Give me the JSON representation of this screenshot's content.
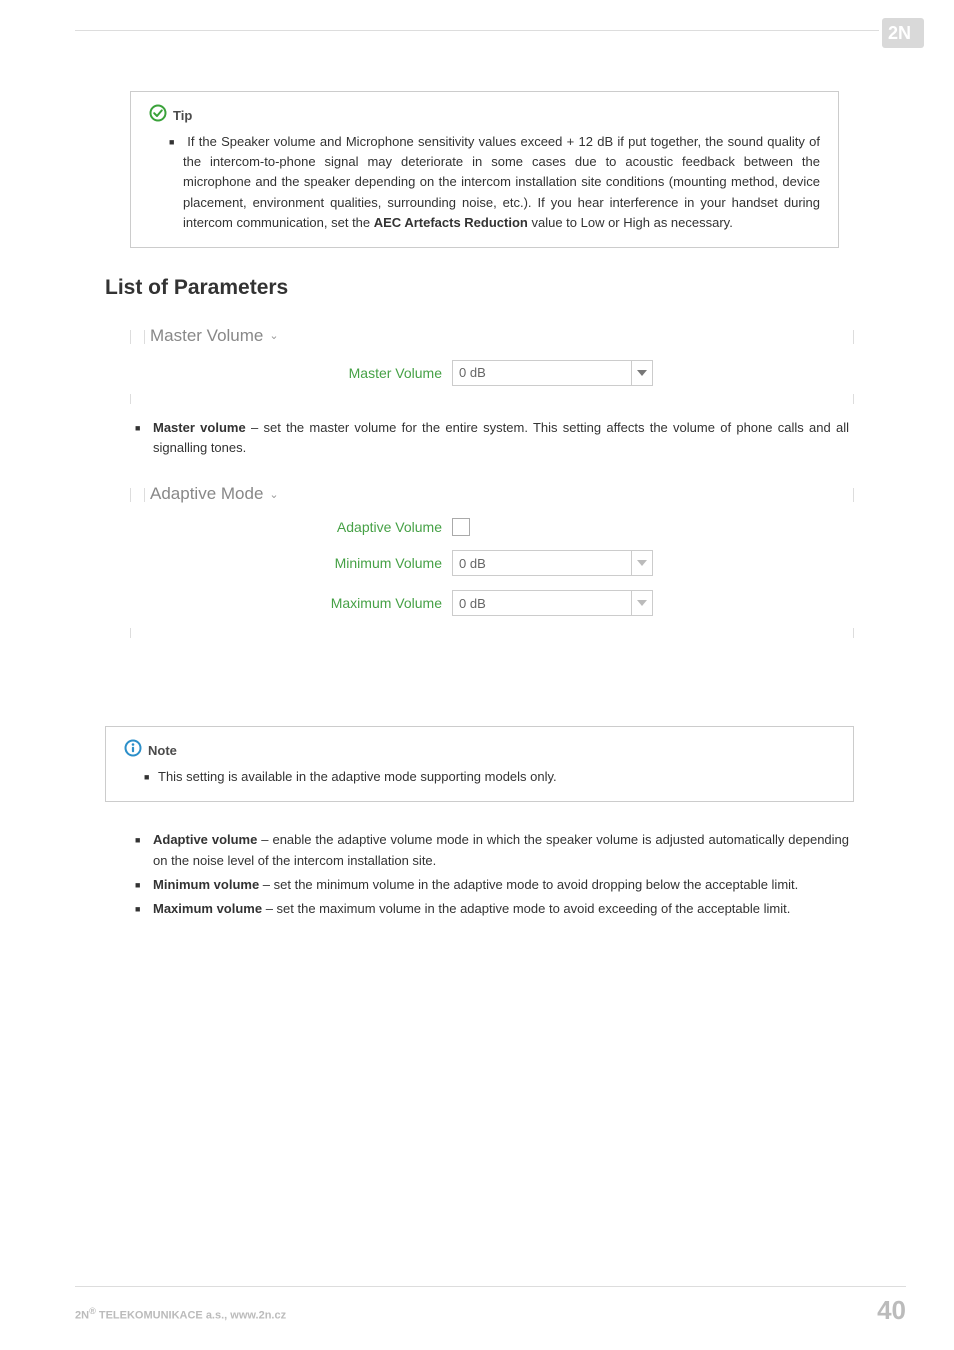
{
  "logo_alt": "2N",
  "tip_box": {
    "title": "Tip",
    "bullet": "If the Speaker volume and Microphone sensitivity values exceed + 12 dB if put together, the sound quality of the intercom-to-phone signal may deteriorate in some cases due to acoustic feedback between the microphone and the speaker depending on the intercom installation site conditions (mounting method, device placement, environment qualities, surrounding noise, etc.). If you hear interference in your handset during intercom communication, set the ",
    "bold_inline": "AEC Artefacts Reduction",
    "bullet_tail": " value to Low or High as necessary."
  },
  "section_heading": "List of Parameters",
  "master_fieldset": {
    "legend": "Master Volume",
    "row_label": "Master Volume",
    "row_value": "0 dB"
  },
  "master_desc": {
    "bold": "Master volume",
    "text": " – set the master volume for the entire system. This setting affects the volume of phone calls and all signalling tones."
  },
  "adaptive_fieldset": {
    "legend": "Adaptive Mode",
    "rows": [
      {
        "label": "Adaptive Volume",
        "type": "checkbox"
      },
      {
        "label": "Minimum Volume",
        "type": "select",
        "value": "0 dB"
      },
      {
        "label": "Maximum Volume",
        "type": "select",
        "value": "0 dB"
      }
    ]
  },
  "note_box": {
    "title": "Note",
    "bullet": "This setting is available in the adaptive mode supporting models only."
  },
  "param_list": [
    {
      "bold": "Adaptive volume",
      "text": " – enable the adaptive volume mode in which the speaker volume is adjusted automatically depending on the noise level of the intercom installation site."
    },
    {
      "bold": "Minimum volume",
      "text": " – set the minimum volume in the adaptive mode to avoid dropping below the acceptable limit."
    },
    {
      "bold": "Maximum volume",
      "text": " – set the maximum volume in the adaptive mode to avoid exceeding of the acceptable limit."
    }
  ],
  "footer": {
    "left_prefix": "2N",
    "left_sup": "®",
    "left_rest": " TELEKOMUNIKACE a.s., www.2n.cz",
    "page": "40"
  }
}
